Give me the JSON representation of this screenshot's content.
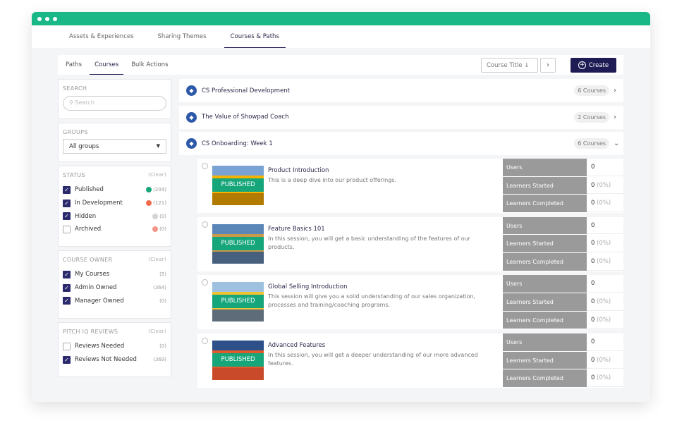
{
  "window": {
    "top_tabs": [
      "Assets & Experiences",
      "Sharing Themes",
      "Courses & Paths"
    ],
    "active_top_tab": 2
  },
  "toolbar": {
    "sub_tabs": [
      "Paths",
      "Courses",
      "Bulk Actions"
    ],
    "active_sub_tab": 1,
    "sort_label": "Course Title",
    "sort_icon": "↓",
    "next_icon": "›",
    "create_label": "Create"
  },
  "sidebar": {
    "search": {
      "title": "SEARCH",
      "placeholder": "Search"
    },
    "groups": {
      "title": "GROUPS",
      "value": "All groups"
    },
    "status": {
      "title": "STATUS",
      "clear": "(Clear)",
      "items": [
        {
          "label": "Published",
          "count": "(204)",
          "checked": true,
          "color": "#16a67a"
        },
        {
          "label": "In Development",
          "count": "(121)",
          "checked": true,
          "color": "#f06a4d"
        },
        {
          "label": "Hidden",
          "count": "(0)",
          "checked": true,
          "color": "#d4d4d4"
        },
        {
          "label": "Archived",
          "count": "(0)",
          "checked": false,
          "color": "#f4968a"
        }
      ]
    },
    "owner": {
      "title": "COURSE OWNER",
      "clear": "(Clear)",
      "items": [
        {
          "label": "My Courses",
          "count": "(5)",
          "checked": true
        },
        {
          "label": "Admin Owned",
          "count": "(364)",
          "checked": true
        },
        {
          "label": "Manager Owned",
          "count": "(0)",
          "checked": true
        }
      ]
    },
    "pitch": {
      "title": "PITCH IQ REVIEWS",
      "clear": "(Clear)",
      "items": [
        {
          "label": "Reviews Needed",
          "count": "(0)",
          "checked": false
        },
        {
          "label": "Reviews Not Needed",
          "count": "(369)",
          "checked": true
        }
      ]
    }
  },
  "paths": [
    {
      "title": "CS Professional Development",
      "count": "6 Courses",
      "expanded": false
    },
    {
      "title": "The Value of Showpad Coach",
      "count": "2 Courses",
      "expanded": false
    },
    {
      "title": "CS Onboarding: Week 1",
      "count": "6 Courses",
      "expanded": true
    }
  ],
  "courses": [
    {
      "title": "Product Introduction",
      "desc": "This is a deep dive into our product offerings.",
      "badge": "PUBLISHED",
      "thumb": [
        "#7aa3d4",
        "#f5b300",
        "#b37a00"
      ]
    },
    {
      "title": "Feature Basics 101",
      "desc": "In this session, you will get a basic understanding of the features of our products.",
      "badge": "PUBLISHED",
      "thumb": [
        "#5b86b8",
        "#c99a4a",
        "#46607e"
      ]
    },
    {
      "title": "Global Selling Introduction",
      "desc": "This session will give you a solid understanding of our sales organization, processes and training/coaching programs.",
      "badge": "PUBLISHED",
      "thumb": [
        "#9fc1e0",
        "#f1c232",
        "#5e6c7a"
      ]
    },
    {
      "title": "Advanced Features",
      "desc": "In this session, you will get a deeper understanding of our more advanced features.",
      "badge": "PUBLISHED",
      "thumb": [
        "#2d4f8a",
        "#e05a2b",
        "#c94a2a"
      ]
    }
  ],
  "stats": {
    "labels": [
      "Users",
      "Learners Started",
      "Learners Completed"
    ],
    "values": [
      "0",
      "0",
      "0"
    ],
    "pcts": [
      "",
      "(0%)",
      "(0%)"
    ]
  }
}
